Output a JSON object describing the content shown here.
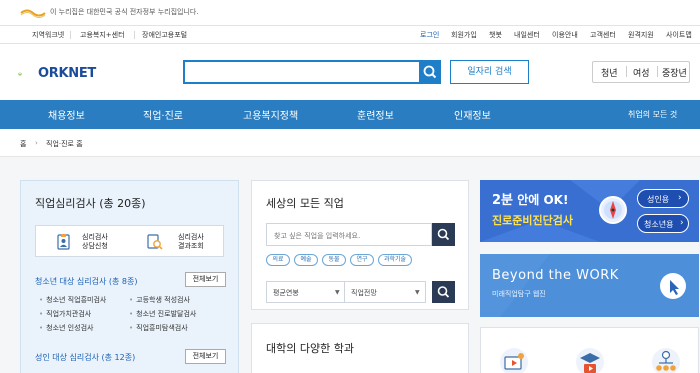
{
  "gov_notice": "이 누리집은 대한민국 공식 전자정부 누리집입니다.",
  "utility_left": [
    "지역워크넷",
    "고용복지+센터",
    "장애인고용포털"
  ],
  "utility_right": [
    "로그인",
    "회원가입",
    "챗봇",
    "내일센터",
    "이용안내",
    "고객센터",
    "원격지원",
    "사이트맵"
  ],
  "logo_text": "ORKNET",
  "search": {
    "placeholder": ""
  },
  "job_search_button": "일자리 검색",
  "age_tabs": [
    "청년",
    "여성",
    "중장년"
  ],
  "main_nav": [
    "채용정보",
    "직업·진로",
    "고용복지정책",
    "훈련정보",
    "인재정보"
  ],
  "nav_all": "취업의 모든 것",
  "breadcrumb": {
    "home": "홈",
    "current": "직업·진로 홈"
  },
  "psych_panel": {
    "title": "직업심리검사 (총 20종)",
    "box": {
      "apply_label": "심리검사\n상담신청",
      "result_label": "심리검사\n결과조회"
    },
    "youth": {
      "title": "청소년 대상 심리검사 (총 8종)",
      "view_all": "전체보기",
      "items": [
        "청소년 직업흥미검사",
        "고등학생 적성검사",
        "직업가치관검사",
        "청소년 진로발달검사",
        "청소년 인성검사",
        "직업흥미탐색검사"
      ]
    },
    "adult": {
      "title": "성인 대상 심리검사 (총 12종)",
      "view_all": "전체보기"
    }
  },
  "jobs_panel": {
    "title": "세상의 모든 직업",
    "input_placeholder": "찾고 싶은 직업을 입력하세요.",
    "tags": [
      "의료",
      "예술",
      "동물",
      "연구",
      "과학기술"
    ],
    "select1": "평균연봉",
    "select2": "직업전망"
  },
  "majors_panel": {
    "title": "대학의 다양한 학과"
  },
  "banner1": {
    "main_time": "2분",
    "main_suffix": " 안에 OK!",
    "sub": "진로준비진단검사",
    "btn1": "성인용",
    "btn2": "청소년용"
  },
  "banner2": {
    "title": "Beyond the WORK",
    "sub": "미래직업탐구 웹진"
  },
  "colors": {
    "nav_blue": "#2a7dc1",
    "search_blue": "#1e7ec8",
    "psych_panel_bg": "#eaf3fb",
    "banner1_bg": "#3b73d6",
    "banner2_bg": "#4b8fd8"
  }
}
